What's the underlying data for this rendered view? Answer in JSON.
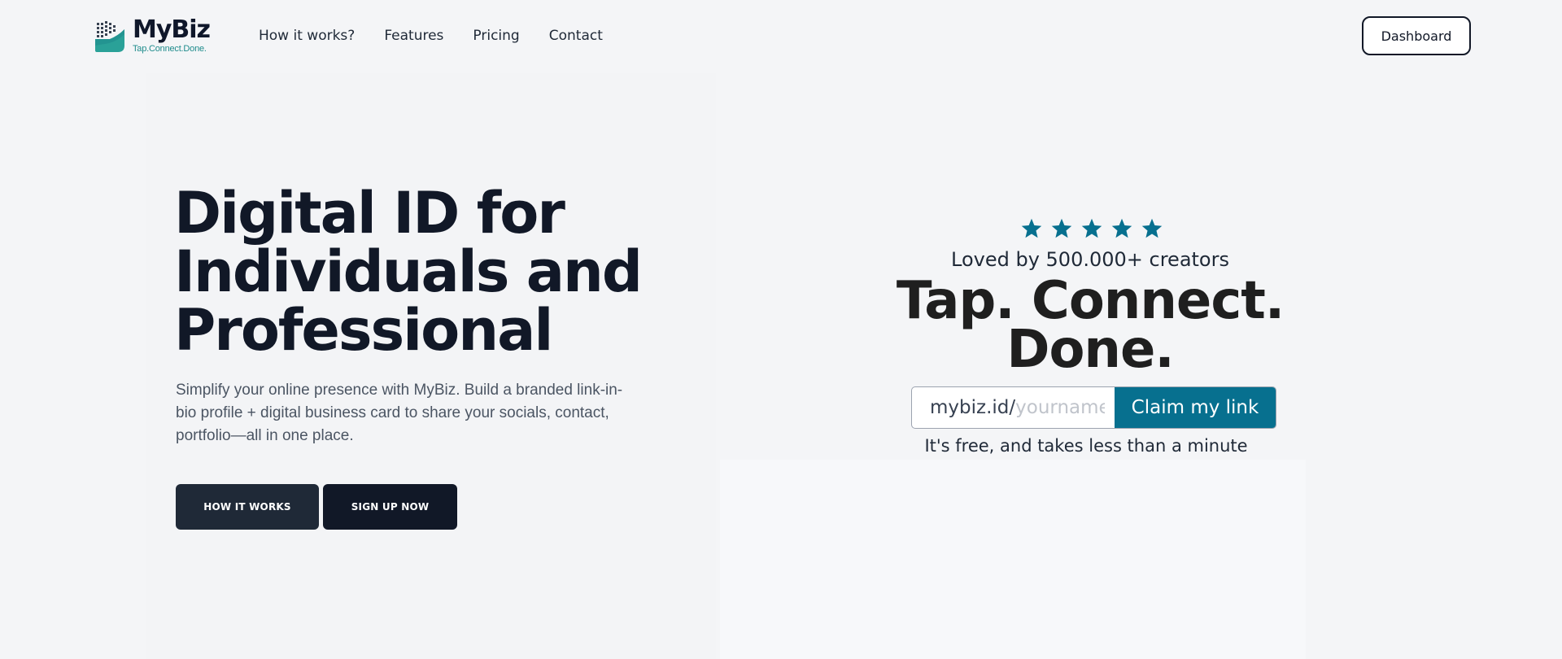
{
  "brand": {
    "name": "MyBiz",
    "tagline": "Tap.Connect.Done.",
    "accent_color": "#1f8c8c"
  },
  "nav": {
    "items": [
      {
        "label": "How it works?"
      },
      {
        "label": "Features"
      },
      {
        "label": "Pricing"
      },
      {
        "label": "Contact"
      }
    ],
    "dashboard_label": "Dashboard"
  },
  "hero": {
    "title": "Digital ID for Individuals and Professional",
    "subtitle": "Simplify your online presence with MyBiz. Build a branded link-in-bio profile + digital business card to share your socials, contact, portfolio—all in one place.",
    "how_button": "HOW IT WORKS",
    "signup_button": "SIGN UP NOW"
  },
  "promo": {
    "stars": 5,
    "star_color": "#07708f",
    "loved_text": "Loved by 500.000+ creators",
    "tagline": "Tap. Connect. Done.",
    "claim_prefix": "mybiz.id/",
    "claim_placeholder": "yourname",
    "claim_button": "Claim my link",
    "claim_button_color": "#07708f",
    "free_note": "It's free, and takes less than a minute"
  }
}
